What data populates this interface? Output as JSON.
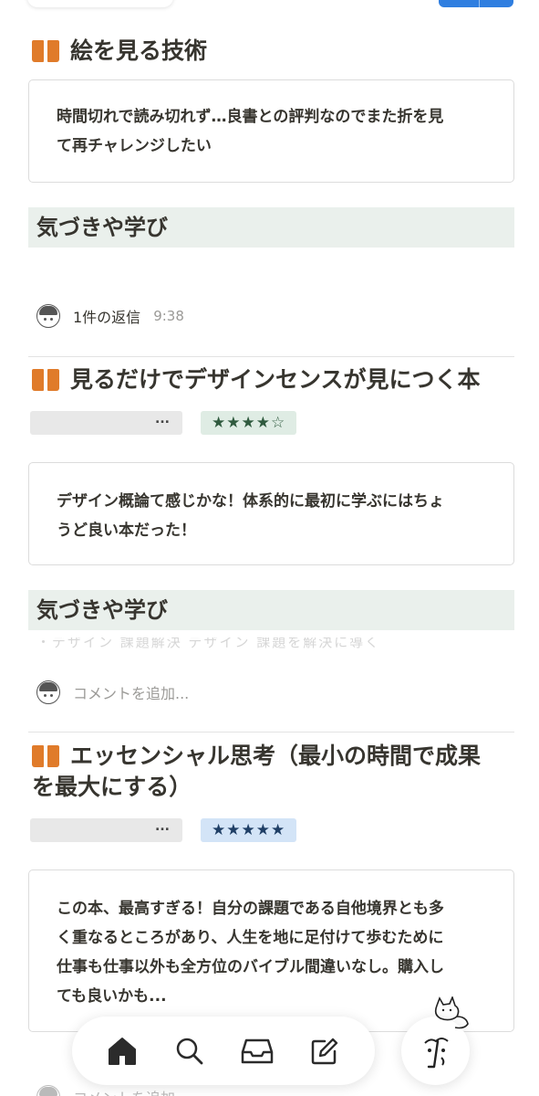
{
  "books": [
    {
      "title": "絵を見る技術",
      "note_lines": [
        "時間切れで読み切れず…良書との評判なのでまた折を見",
        "て再チャレンジしたい"
      ],
      "section_heading": "気づきや学び",
      "reply_text": "1件の返信",
      "reply_time": "9:38"
    },
    {
      "title": "見るだけでデザインセンスが見につく本",
      "tag_ellipsis": "...",
      "rating": "★★★★☆",
      "note_lines": [
        "デザイン概論て感じかな！体系的に最初に学ぶにはちょ",
        "うど良い本だった！"
      ],
      "section_heading": "気づきや学び",
      "comment_placeholder": "コメントを追加..."
    },
    {
      "title_lines": [
        "エッセンシャル思考（最小の時間で成果",
        "を最大にする）"
      ],
      "tag_ellipsis": "...",
      "rating": "★★★★★",
      "note_lines": [
        "この本、最高すぎる！自分の課題である自他境界とも多",
        "く重なるところがあり、人生を地に足付けて歩むために",
        "仕事も仕事以外も全方位のバイブル間違いなし。購入し",
        "ても良いかも..."
      ],
      "comment_placeholder": "コメントを追加..."
    }
  ],
  "bottom_nav": {
    "items": [
      "home-icon",
      "search-icon",
      "inbox-icon",
      "compose-icon"
    ]
  },
  "colors": {
    "book_icon": "#e07b2a",
    "section_bg": "#eaf0ec",
    "rating_green_bg": "#dfece4",
    "rating_blue_bg": "#d3e4f7",
    "top_button": "#2f7ee0"
  }
}
